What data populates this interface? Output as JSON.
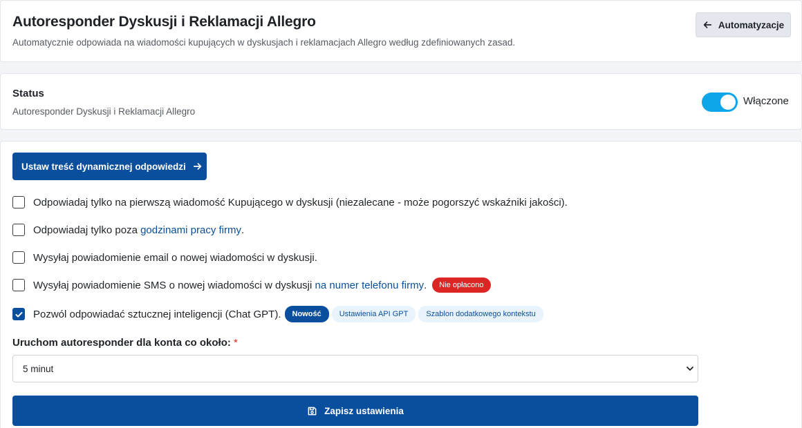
{
  "header": {
    "title": "Autoresponder Dyskusji i Reklamacji Allegro",
    "subtitle": "Automatycznie odpowiada na wiadomości kupujących w dyskusjach i reklamacjach Allegro według zdefiniowanych zasad.",
    "back_button_label": "Automatyzacje",
    "back_icon": "arrow-left-icon"
  },
  "status": {
    "title": "Status",
    "subtitle": "Autoresponder Dyskusji i Reklamacji Allegro",
    "toggle_on": true,
    "toggle_label": "Włączone"
  },
  "settings": {
    "dynamic_button_label": "Ustaw treść dynamicznej odpowiedzi",
    "options": [
      {
        "checked": false,
        "text": "Odpowiadaj tylko na pierwszą wiadomość Kupującego w dyskusji (niezalecane - może pogorszyć wskaźniki jakości)."
      },
      {
        "checked": false,
        "text": "Odpowiadaj tylko poza ",
        "link": "godzinami pracy firmy",
        "suffix": "."
      },
      {
        "checked": false,
        "text": "Wysyłaj powiadomienie email o nowej wiadomości w dyskusji."
      },
      {
        "checked": false,
        "text": "Wysyłaj powiadomienie SMS o nowej wiadomości w dyskusji ",
        "link": "na numer telefonu firmy",
        "suffix": ".",
        "badge": "Nie opłacono"
      },
      {
        "checked": true,
        "text": "Pozwól odpowiadać sztucznej inteligencji (Chat GPT).",
        "badge": "Nowość",
        "links": [
          "Ustawienia API GPT",
          "Szablon dodatkowego kontekstu"
        ]
      }
    ],
    "interval_label": "Uruchom autoresponder dla konta co około:",
    "required_mark": "*",
    "interval_value": "5 minut",
    "save_label": "Zapisz ustawienia"
  },
  "colors": {
    "primary": "#0a4f9e",
    "toggle": "#0ea5e9",
    "danger": "#dc2626"
  }
}
